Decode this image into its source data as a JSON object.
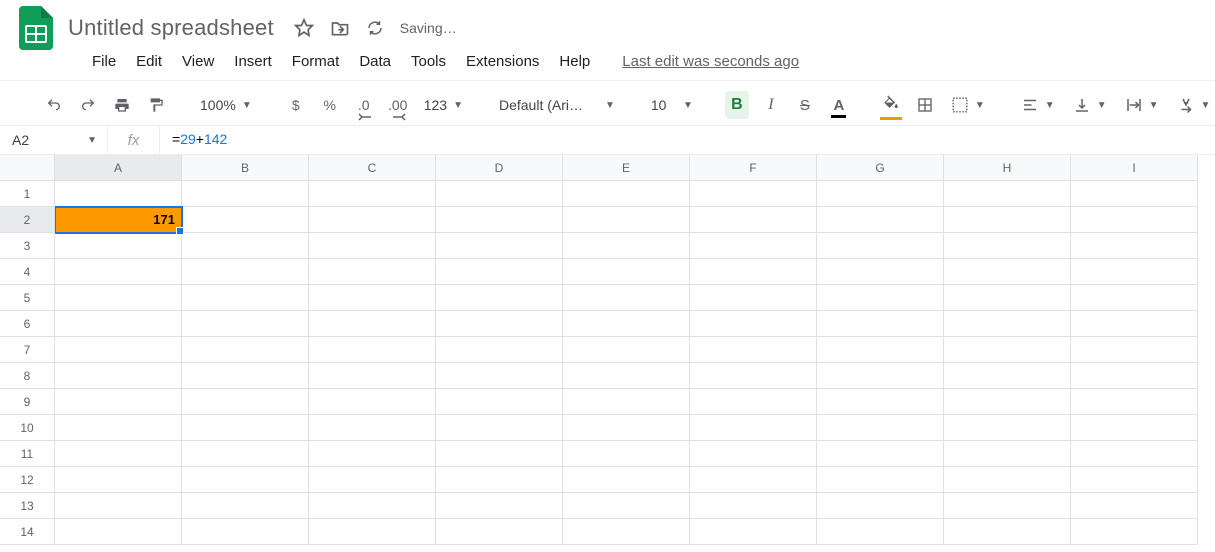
{
  "header": {
    "doc_title": "Untitled spreadsheet",
    "saving": "Saving…",
    "last_edit": "Last edit was seconds ago"
  },
  "menu": [
    "File",
    "Edit",
    "View",
    "Insert",
    "Format",
    "Data",
    "Tools",
    "Extensions",
    "Help"
  ],
  "toolbar": {
    "zoom": "100%",
    "currency": "$",
    "percent": "%",
    "dec_dec": ".0",
    "dec_inc": ".00",
    "num_format": "123",
    "font": "Default (Ari…",
    "font_size": "10",
    "bold": "B",
    "italic": "I",
    "strike": "S",
    "text_color_letter": "A",
    "fill_color_icon": "↑"
  },
  "fx_row": {
    "name_box": "A2",
    "fx_label": "fx",
    "formula_eq": "=",
    "formula_num1": "29",
    "formula_op": "+",
    "formula_num2": "142"
  },
  "columns": [
    "A",
    "B",
    "C",
    "D",
    "E",
    "F",
    "G",
    "H",
    "I"
  ],
  "rows": [
    "1",
    "2",
    "3",
    "4",
    "5",
    "6",
    "7",
    "8",
    "9",
    "10",
    "11",
    "12",
    "13",
    "14"
  ],
  "cells": {
    "A2": "171"
  },
  "active_cell": "A2",
  "colors": {
    "highlight": "#ff9900",
    "accent": "#1a73e8"
  }
}
